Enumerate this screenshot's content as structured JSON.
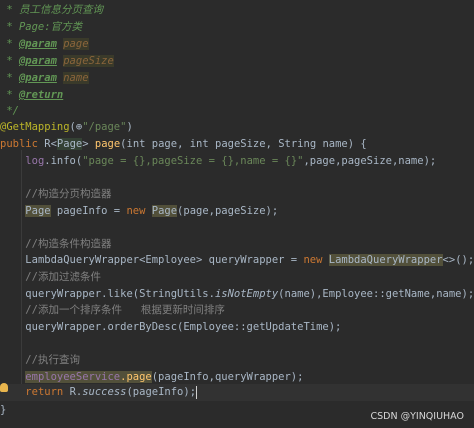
{
  "code": {
    "doc_summary": "员工信息分页查询",
    "doc_page_label": "Page:",
    "doc_page_desc": "官方类",
    "param_tag": "@param",
    "return_tag": "@return",
    "param1": "page",
    "param2": "pageSize",
    "param3": "name",
    "doc_open_prefix": " * ",
    "doc_end": " */",
    "annotation": "@GetMapping",
    "mapping_path": "\"/page\"",
    "line_method_sig_a": "public ",
    "line_method_sig_b": "R<",
    "line_method_type": "Page",
    "line_method_sig_c": "> ",
    "line_method_name": "page",
    "line_method_params": "(int page, int pageSize, String name) {",
    "log_stmt_a": "log",
    "log_stmt_b": ".info(",
    "log_stmt_str": "\"page = {},pageSize = {},name = {}\"",
    "log_stmt_c": ",page,pageSize,name);",
    "comment1": "//构造分页构造器",
    "pageinfo_type": "Page",
    "pageinfo_a": " pageInfo = ",
    "pageinfo_new": "new ",
    "pageinfo_ctor": "Page",
    "pageinfo_b": "(page,pageSize);",
    "comment2": "//构造条件构造器",
    "lqw_a": "LambdaQueryWrapper<Employee> queryWrapper = ",
    "lqw_new": "new ",
    "lqw_ctor": "LambdaQueryWrapper",
    "lqw_b": "<>();",
    "comment3": "//添加过滤条件",
    "like_a": "queryWrapper.like(StringUtils.",
    "like_method": "isNotEmpty",
    "like_b": "(name),Employee::getName,name);",
    "comment4": "//添加一个排序条件   根据更新时间排序",
    "order_stmt": "queryWrapper.orderByDesc(Employee::getUpdateTime);",
    "comment5": "//执行查询",
    "svc_name": "employeeService",
    "svc_call": ".page",
    "svc_args": "(pageInfo,queryWrapper);",
    "return_kw": "return ",
    "return_a": "R.",
    "return_method": "success",
    "return_b": "(pageInfo);",
    "close_brace": "}",
    "annotation_globe": "⊕",
    "annotation_tail": ")"
  },
  "watermark": "CSDN @YINQIUHAO"
}
